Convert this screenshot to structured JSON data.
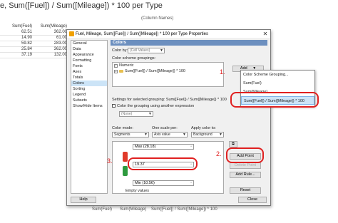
{
  "background": {
    "title": "e, Sum([Fuel]) / Sum([Mileage]) * 100 per Type",
    "column_names_label": "(Column Names)",
    "table_headers": [
      "Sum(Fuel)",
      "Sum(Mileage)"
    ],
    "table_rows": [
      [
        "62.51",
        "362.00"
      ],
      [
        "14.90",
        "61.00"
      ],
      [
        "59.82",
        "283.00"
      ],
      [
        "25.84",
        "362.00"
      ],
      [
        "37.19",
        "132.00"
      ]
    ],
    "bottom_labels": [
      "Sum(Fuel)",
      "Sum(Mileage)",
      "Sum([Fuel]) / Sum([Mileage]) * 100"
    ]
  },
  "dialog": {
    "title": "Fuel, Mileage, Sum([Fuel]) / Sum([Mileage]) * 100 per Type Properties",
    "close_glyph": "✕",
    "nav_items": [
      "General",
      "Data",
      "Appearance",
      "Formatting",
      "Fonts",
      "Axes",
      "Totals",
      "Colors",
      "Sorting",
      "Legend",
      "Subsets",
      "Show/Hide Items"
    ],
    "active_nav": "Colors",
    "panel": {
      "header": "Colors",
      "color_by_label": "Color by:",
      "color_by_value": "(Cell Values)",
      "groupings_label": "Color scheme groupings:",
      "tree_items": [
        {
          "expander": "+",
          "label": "Numeric"
        },
        {
          "expander": "+",
          "label": "Sum([Fuel]) / Sum([Mileage]) * 100"
        }
      ],
      "add_button": "Add",
      "add_arrow": "▼",
      "settings_label": "Settings for selected grouping: Sum([Fuel]) / Sum([Mileage]) * 100",
      "expression_checkbox": "Color the grouping using another expression",
      "expression_value": "(None)",
      "color_mode_label": "Color mode:",
      "color_mode_value": "Segments",
      "one_scale_label": "One scale per:",
      "one_scale_value": "Axis value",
      "apply_label": "Apply color to:",
      "apply_value": "Background",
      "max_label": "Max (28.18)",
      "mid_value": "19.37",
      "min_label": "Min (10.56)",
      "empty_values": "Empty values",
      "add_point": "Add Point",
      "delete_point": "Delete Point",
      "add_rule": "Add Rule...",
      "reset": "Reset"
    },
    "help_button": "Help",
    "close_button": "Close"
  },
  "dropdown": {
    "items": [
      "Color Scheme Grouping...",
      "Sum(Fuel)",
      "Sum(Mileage)",
      "Sum([Fuel]) / Sum([Mileage]) * 100"
    ]
  },
  "annotations": [
    "1.",
    "2.",
    "3."
  ],
  "colors": {
    "header_blue": "#6c8fbf",
    "annotation_red": "#e02020",
    "segment_red": "#e03a2a",
    "segment_green": "#2e9a3e"
  }
}
